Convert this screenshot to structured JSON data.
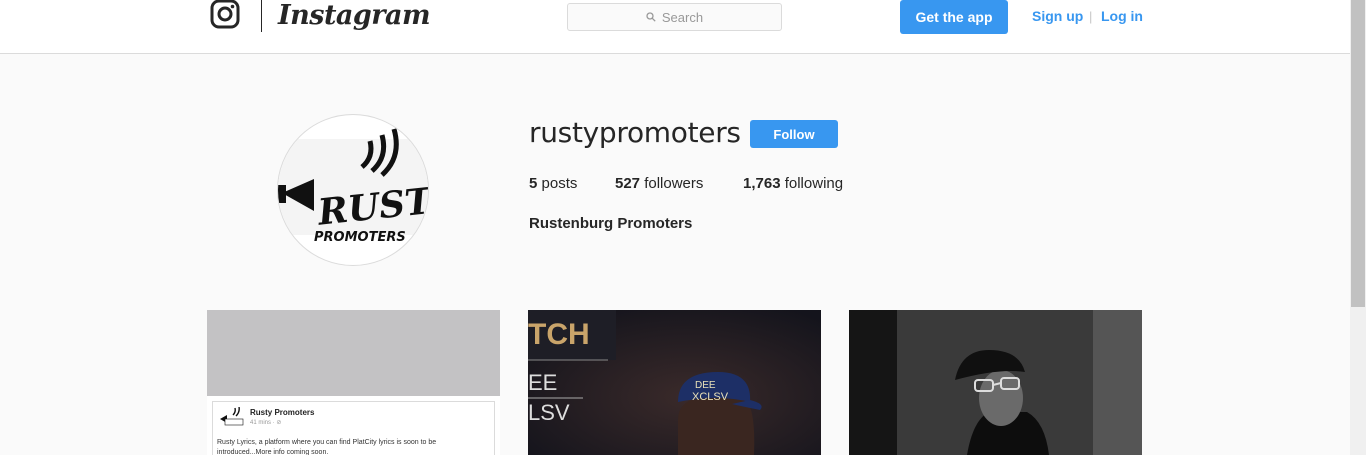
{
  "header": {
    "wordmark": "Instagram",
    "search_placeholder": "Search",
    "get_app_label": "Get the app",
    "signup_label": "Sign up",
    "separator": "|",
    "login_label": "Log in"
  },
  "profile": {
    "username": "rustypromoters",
    "follow_label": "Follow",
    "posts_count": "5",
    "posts_label": "posts",
    "followers_count": "527",
    "followers_label": "followers",
    "following_count": "1,763",
    "following_label": "following",
    "full_name": "Rustenburg Promoters",
    "avatar_text_top": "RUSTY",
    "avatar_text_bottom": "PROMOTERS"
  },
  "posts": [
    {
      "fb_name": "Rusty Promoters",
      "fb_time": "41 mins · ⊘",
      "fb_text": "Rusty Lyrics, a platform where you can find PlatCity lyrics is soon to be introduced...More info coming soon."
    },
    {
      "banner": "TCH",
      "line1": "EE",
      "line2": "LSV",
      "cap_line1": "DEE",
      "cap_line2": "XCLSV"
    },
    {}
  ],
  "colors": {
    "accent": "#3897f0",
    "border": "#dbdbdb",
    "background": "#fafafa"
  }
}
